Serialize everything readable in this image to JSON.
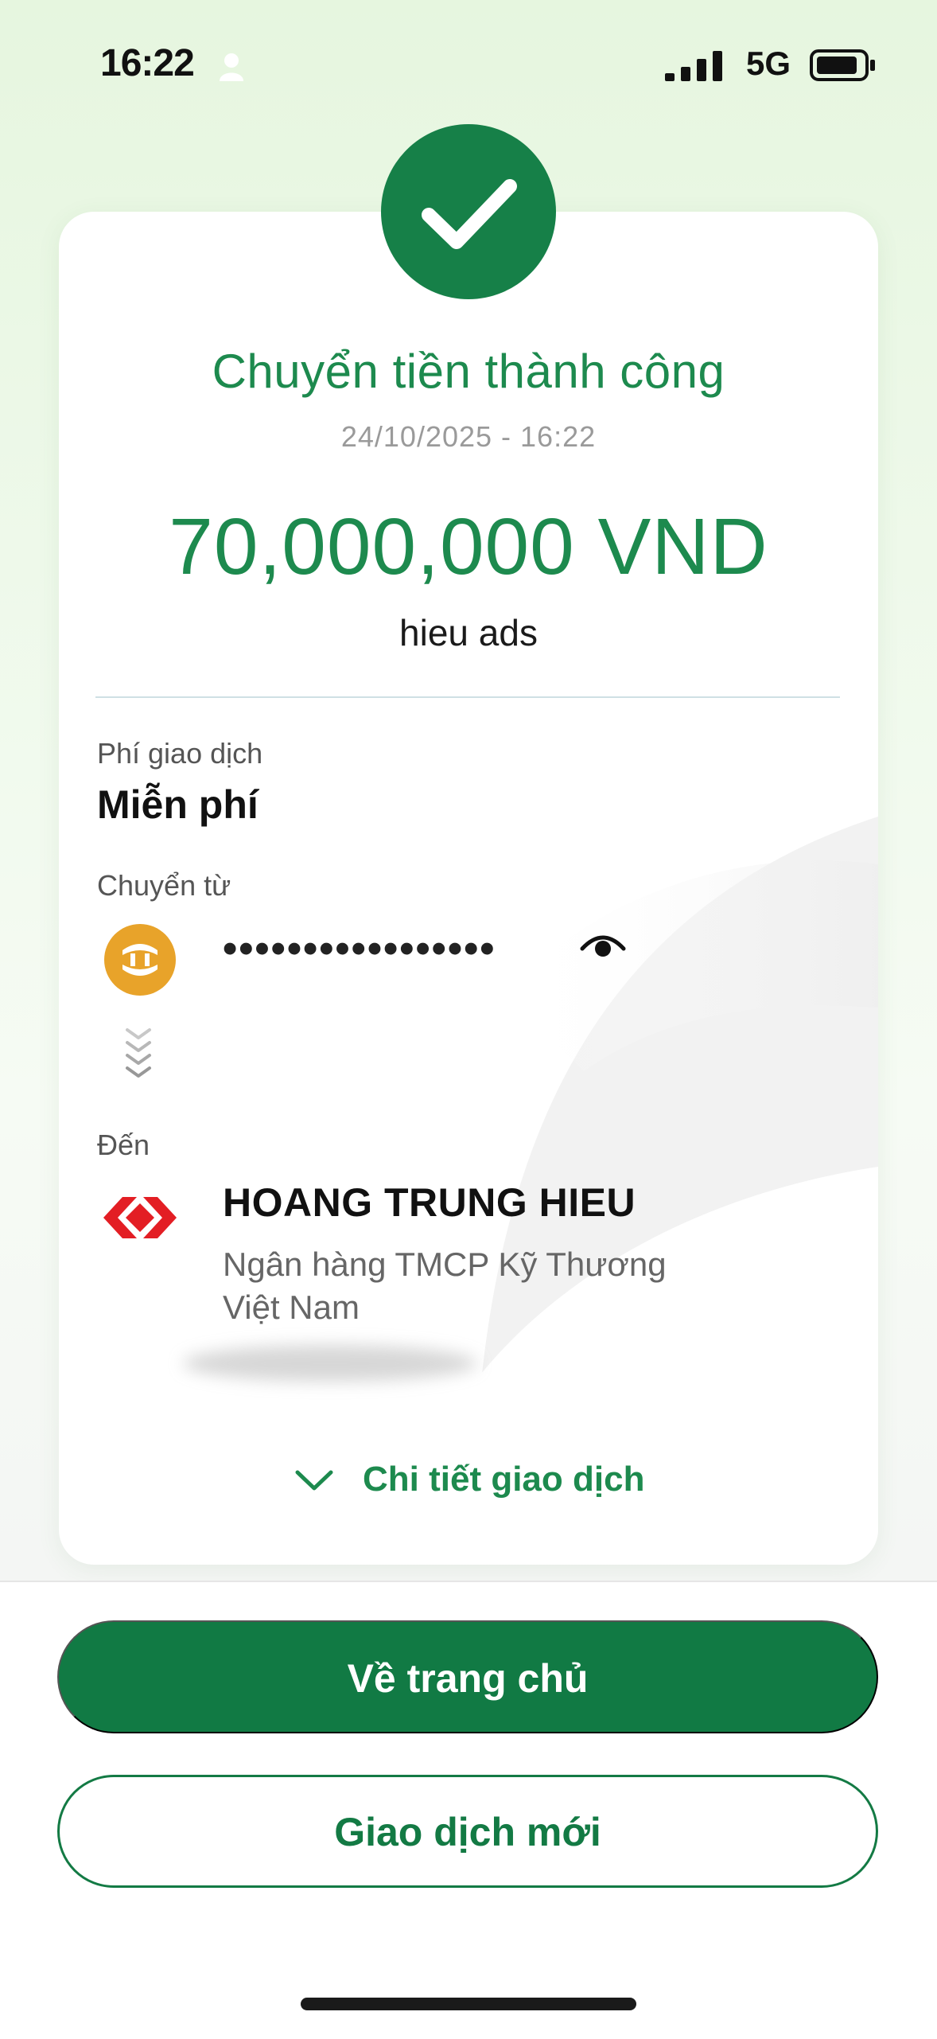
{
  "status_bar": {
    "time": "16:22",
    "network": "5G",
    "icons": [
      "person-icon",
      "signal-icon",
      "battery-icon"
    ]
  },
  "receipt": {
    "title": "Chuyển tiền thành công",
    "datetime": "24/10/2025 - 16:22",
    "amount": "70,000,000 VND",
    "note": "hieu ads",
    "fee": {
      "label": "Phí giao dịch",
      "value": "Miễn phí"
    },
    "from": {
      "label": "Chuyển từ",
      "masked_account": "•••••••••••••••••",
      "logo_icon": "bank-logo-icon",
      "toggle_icon": "eye-icon"
    },
    "to": {
      "label": "Đến",
      "name": "HOANG TRUNG HIEU",
      "bank": "Ngân hàng TMCP Kỹ Thương Việt Nam",
      "logo_icon": "techcombank-logo-icon"
    },
    "details_link": "Chi tiết giao dịch"
  },
  "actions": {
    "home": "Về trang chủ",
    "new_transaction": "Giao dịch mới"
  },
  "colors": {
    "brand_green": "#168048",
    "text_green": "#1d8a4e",
    "source_logo": "#e8a32a",
    "dest_logo": "#e31e24"
  }
}
